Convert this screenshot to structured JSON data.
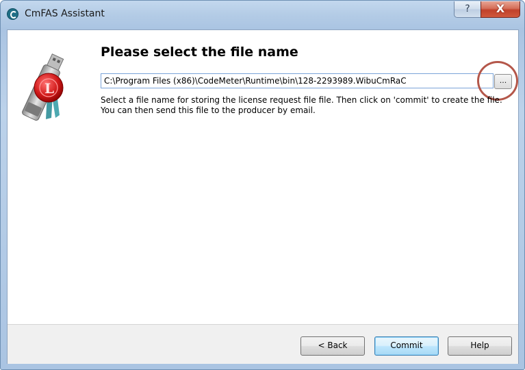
{
  "window": {
    "title": "CmFAS Assistant",
    "help_label": "?",
    "close_label": "X"
  },
  "main": {
    "heading": "Please select the file name",
    "file_path": "C:\\Program Files (x86)\\CodeMeter\\Runtime\\bin\\128-2293989.WibuCmRaC",
    "browse_label": "...",
    "description": [
      "Select a file name for storing the license request file file. Then click on 'commit' to create the file.",
      "You can then send this file to the producer by email."
    ]
  },
  "buttons": {
    "back": "< Back",
    "commit": "Commit",
    "help": "Help"
  },
  "colors": {
    "accent_highlight": "#b4574a",
    "title_bar": "#b4cce6"
  },
  "icons": {
    "app": "cmfas-app-icon",
    "logo": "usb-license-seal-icon"
  }
}
